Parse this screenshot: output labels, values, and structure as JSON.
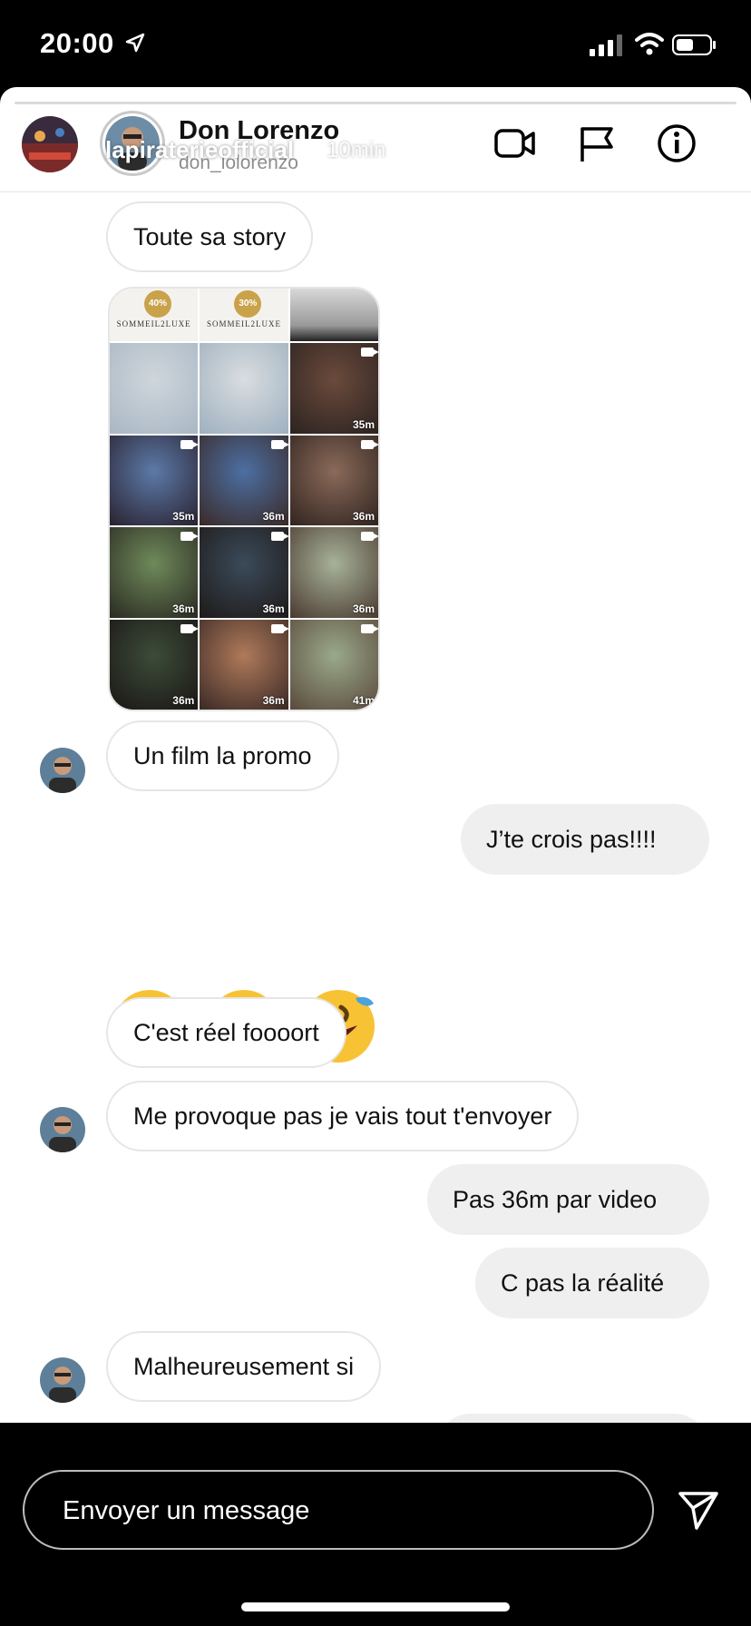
{
  "status": {
    "time": "20:00"
  },
  "header": {
    "dm_name": "Don Lorenzo",
    "dm_username": "don_lolorenzo",
    "story_username": "lapiraterieofficial",
    "story_time": "10min",
    "icons": [
      "video-camera-icon",
      "flag-icon",
      "more-icon",
      "info-icon",
      "close-icon"
    ]
  },
  "thread": {
    "messages": [
      {
        "id": "m1",
        "side": "in",
        "text": "Toute sa story"
      },
      {
        "id": "m2",
        "side": "in",
        "text": "Un film la promo"
      },
      {
        "id": "m3",
        "side": "out",
        "text": "J’te crois pas!!!!"
      },
      {
        "id": "m4",
        "side": "in",
        "text": "🤣🤣🤣"
      },
      {
        "id": "m5",
        "side": "in",
        "text": "C'est réel foooort"
      },
      {
        "id": "m6",
        "side": "in",
        "text": "Me provoque pas je vais tout t'envoyer"
      },
      {
        "id": "m7",
        "side": "out",
        "text": "Pas 36m par video"
      },
      {
        "id": "m8",
        "side": "out",
        "text": "C pas la réalité"
      },
      {
        "id": "m9",
        "side": "in",
        "text": "Malheureusement si"
      }
    ],
    "shared_story_grid": {
      "ads": [
        {
          "badge": "40%",
          "brand": "SOMMEIL2LUXE"
        },
        {
          "badge": "30%",
          "brand": "SOMMEIL2LUXE"
        }
      ],
      "tile_labels": [
        "35m",
        "35m",
        "36m",
        "36m",
        "36m",
        "36m",
        "36m",
        "36m",
        "36m",
        "41m"
      ]
    }
  },
  "composer": {
    "placeholder": "Envoyer un message"
  },
  "colors": {
    "accent_ring": "#c9c9c9",
    "outgoing_bubble": "#efefef",
    "ad_gold": "#c9a24a"
  }
}
